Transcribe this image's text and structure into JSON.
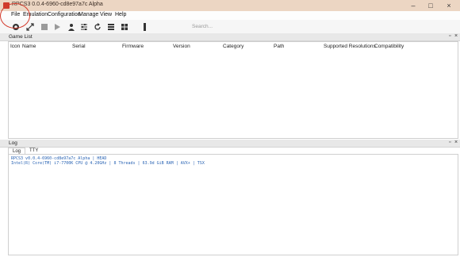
{
  "window": {
    "title": "RPCS3 0.0.4-6960-cd8e97a7c Alpha",
    "buttons": [
      "–",
      "□",
      "×"
    ]
  },
  "menu": [
    "File",
    "Emulation",
    "Configuration",
    "Manage",
    "View",
    "Help"
  ],
  "toolbar": {
    "icons": [
      "gear-icon",
      "fullscreen-icon",
      "stop-icon",
      "play-icon",
      "user-icon",
      "sliders-icon",
      "refresh-icon",
      "list-view-icon",
      "grid-view-icon",
      "slider-handle-icon"
    ],
    "search_placeholder": "Search..."
  },
  "game_list": {
    "title": "Game List",
    "columns": [
      "Icon",
      "Name",
      "Serial",
      "Firmware",
      "Version",
      "Category",
      "Path",
      "Supported Resolutions",
      "Compatibility"
    ]
  },
  "log_panel": {
    "title": "Log",
    "tabs": [
      "Log",
      "TTY"
    ],
    "lines": [
      "RPCS3 v0.0.4-6960-cd8e97a7c Alpha | HEAD",
      "Intel(R) Core(TM) i7-7700K CPU @ 4.20GHz | 8 Threads | 63.9d GiB RAM | AVX+ | TSX"
    ]
  },
  "colors": {
    "titlebar": "#ecd6c3",
    "log_text": "#2a64b4",
    "annotation": "#d43a2b"
  }
}
